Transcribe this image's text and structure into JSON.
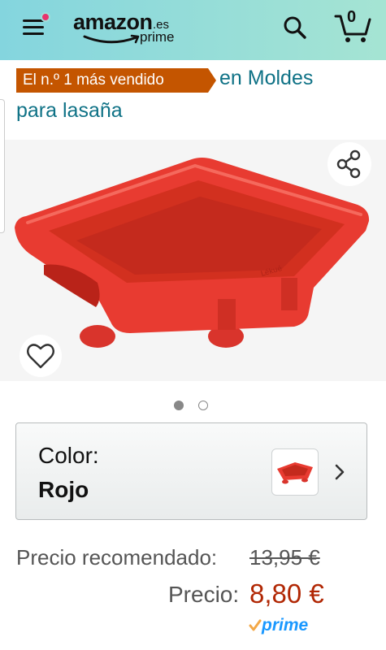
{
  "header": {
    "logo_word": "amazon",
    "logo_tld": ".es",
    "logo_sub": "prime",
    "cart_count": "0",
    "menu_icon": "hamburger-menu-icon",
    "search_icon": "search-icon",
    "cart_icon": "cart-icon",
    "notification_color": "#e8336c"
  },
  "bestseller": {
    "badge": "El n.º 1 más vendido",
    "category_line1": "en Moldes",
    "category_line2": "para lasaña",
    "badge_color": "#c45500",
    "link_color": "#0f7286"
  },
  "gallery": {
    "share_icon": "share-icon",
    "wishlist_icon": "heart-icon",
    "current_image": 1,
    "image_count": 2
  },
  "variation": {
    "label": "Color:",
    "value": "Rojo",
    "chevron_icon": "chevron-right-icon"
  },
  "pricing": {
    "recommended_label": "Precio recomendado:",
    "recommended_value": "13,95 €",
    "price_label": "Precio:",
    "price_value": "8,80 €",
    "prime_label": "prime",
    "price_color": "#b12704",
    "prime_color": "#1a98ff"
  }
}
